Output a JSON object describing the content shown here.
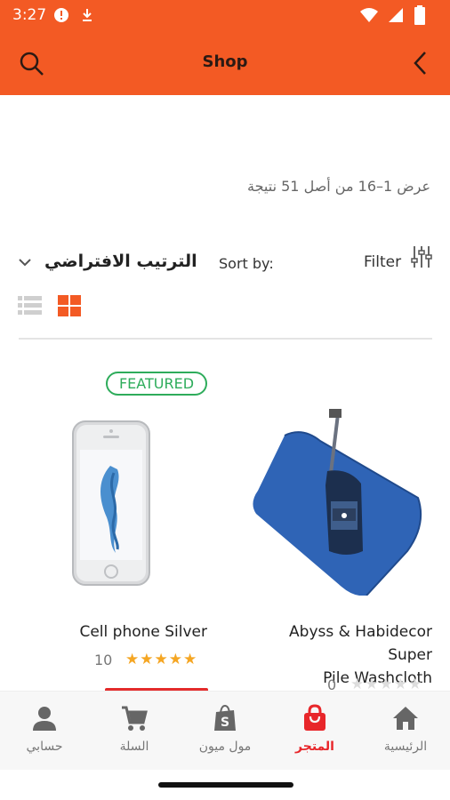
{
  "status_bar": {
    "time": "3:27"
  },
  "header": {
    "title": "Shop"
  },
  "results_text": "عرض 1–16 من أصل 51 نتيجة",
  "sort": {
    "label": "Sort by:",
    "value": "الترتيب الافتراضي"
  },
  "filter": {
    "label": "Filter"
  },
  "view_mode": {
    "selected": "grid"
  },
  "products": [
    {
      "badge": "FEATURED",
      "name": "Cell phone Silver",
      "rating": 5,
      "rating_count": "10"
    },
    {
      "name_line1": "Abyss & Habidecor Super",
      "name_line2": "Pile Washcloth",
      "rating": 0,
      "rating_count": "0"
    }
  ],
  "bottom_nav": [
    {
      "label": "حسابي",
      "icon": "person-icon"
    },
    {
      "label": "السلة",
      "icon": "cart-icon"
    },
    {
      "label": "مول ميون",
      "icon": "shopify-bag-icon"
    },
    {
      "label": "المتجر",
      "icon": "shopping-bag-icon",
      "active": true
    },
    {
      "label": "الرئيسية",
      "icon": "home-icon"
    }
  ],
  "colors": {
    "brand": "#f35a24",
    "active_nav": "#e8262a",
    "featured": "#2eac5b",
    "star": "#f5a623",
    "star_empty": "#dddddd"
  }
}
